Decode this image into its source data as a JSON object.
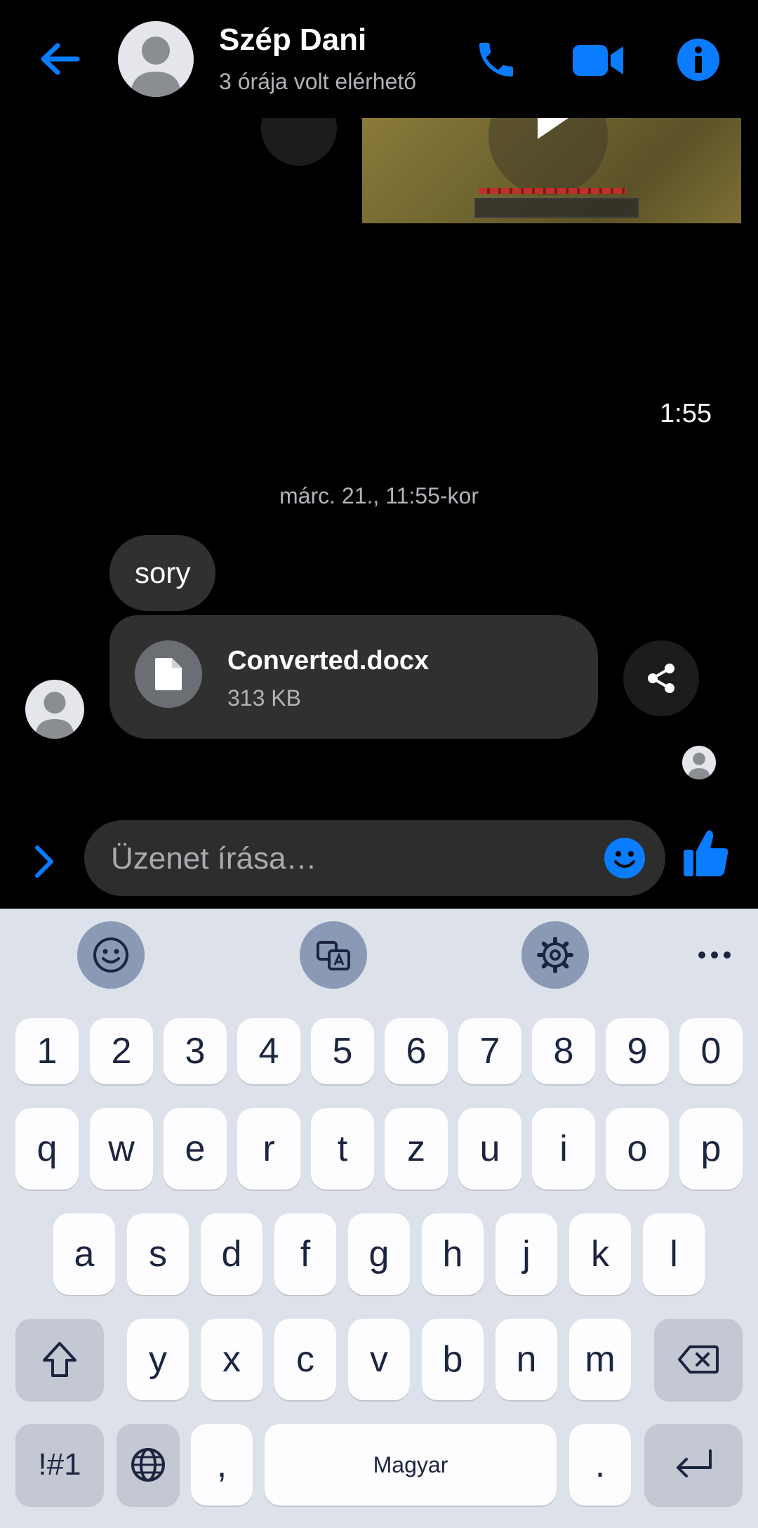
{
  "header": {
    "contact_name": "Szép Dani",
    "status": "3 órája volt elérhető",
    "icons": [
      "back-arrow-icon",
      "phone-icon",
      "video-camera-icon",
      "info-icon"
    ],
    "accent_color": "#0a7cff"
  },
  "chat": {
    "sent_time": "1:55",
    "date_divider": "márc. 21., 11:55-kor",
    "messages": [
      {
        "text": "sory"
      }
    ],
    "attachment": {
      "file_name": "Converted.docx",
      "file_size": "313 KB"
    }
  },
  "composer": {
    "placeholder": "Üzenet írása…"
  },
  "keyboard": {
    "number_row": [
      "1",
      "2",
      "3",
      "4",
      "5",
      "6",
      "7",
      "8",
      "9",
      "0"
    ],
    "row1": [
      "q",
      "w",
      "e",
      "r",
      "t",
      "z",
      "u",
      "i",
      "o",
      "p"
    ],
    "row2": [
      "a",
      "s",
      "d",
      "f",
      "g",
      "h",
      "j",
      "k",
      "l"
    ],
    "row3": [
      "y",
      "x",
      "c",
      "v",
      "b",
      "n",
      "m"
    ],
    "symbols_label": "!#1",
    "comma": ",",
    "space_label": "Magyar",
    "period": "."
  }
}
